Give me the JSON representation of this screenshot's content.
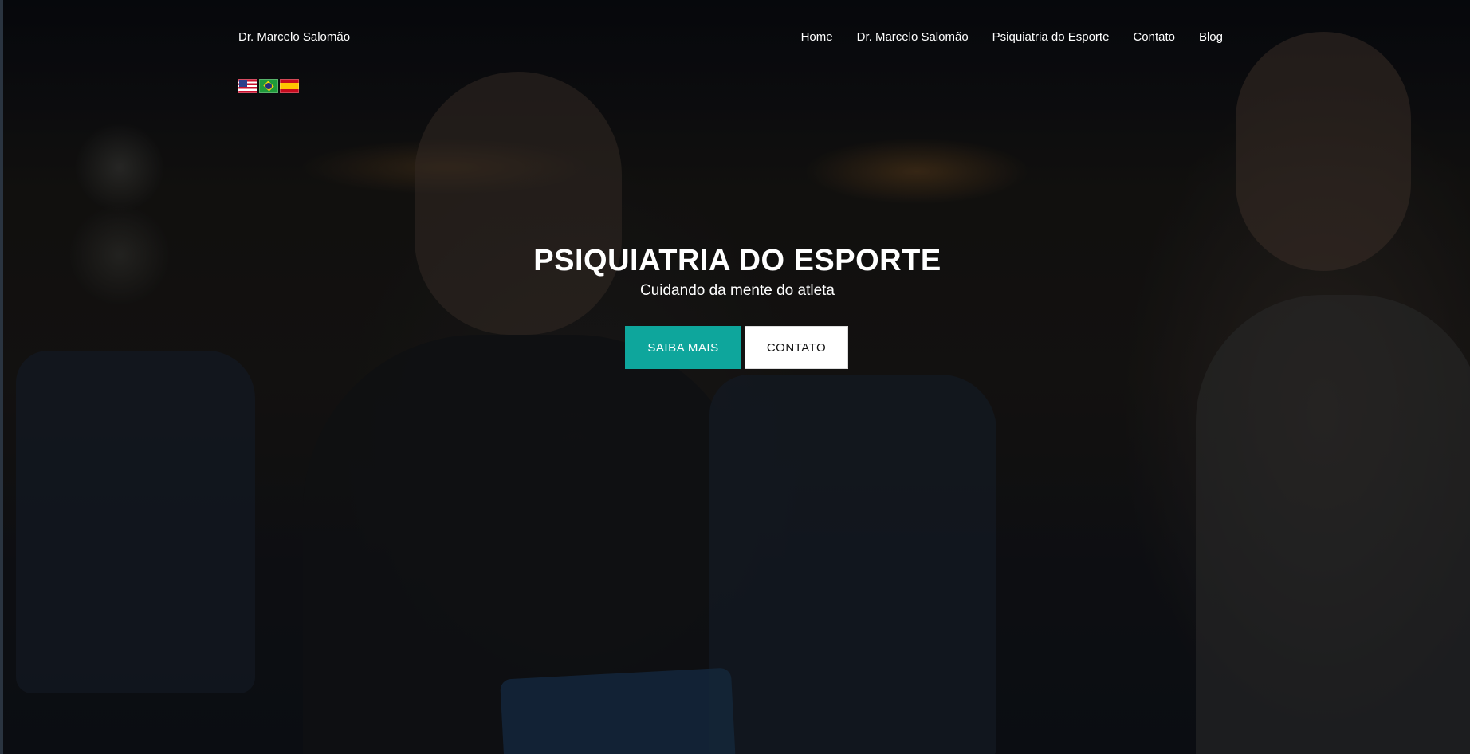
{
  "header": {
    "brand": "Dr. Marcelo Salomão",
    "nav": [
      {
        "label": "Home"
      },
      {
        "label": "Dr. Marcelo Salomão"
      },
      {
        "label": "Psiquiatria do Esporte"
      },
      {
        "label": "Contato"
      },
      {
        "label": "Blog"
      }
    ],
    "languages": [
      {
        "icon": "us-flag-icon"
      },
      {
        "icon": "brazil-flag-icon"
      },
      {
        "icon": "spain-flag-icon"
      }
    ]
  },
  "hero": {
    "title": "PSIQUIATRIA DO ESPORTE",
    "subtitle": "Cuidando da mente do atleta",
    "primary_button": "SAIBA MAIS",
    "secondary_button": "CONTATO"
  },
  "colors": {
    "accent": "#0ea69c",
    "text": "#ffffff"
  }
}
